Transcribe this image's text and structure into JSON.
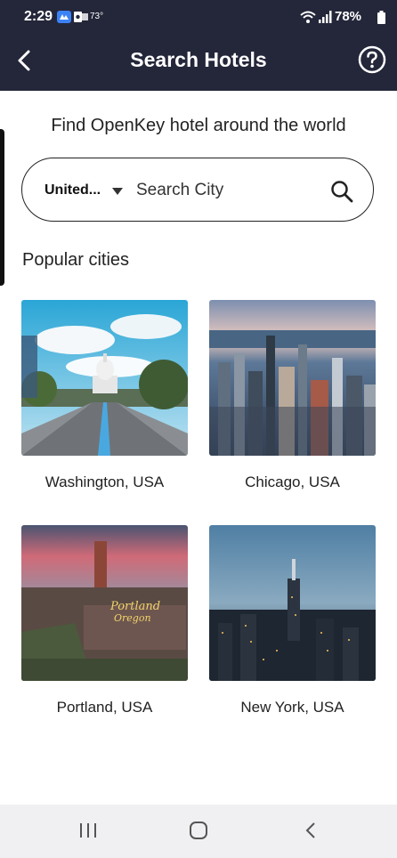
{
  "status_bar": {
    "time": "2:29",
    "temperature": "73°",
    "battery": "78%",
    "icons": [
      "app-notification-icon",
      "outlook-icon",
      "wifi-icon",
      "signal-icon",
      "battery-icon"
    ]
  },
  "header": {
    "title": "Search Hotels",
    "back_icon": "back-chevron-icon",
    "help_icon": "help-circle-icon"
  },
  "main": {
    "subtitle": "Find OpenKey hotel around the world",
    "search": {
      "country": "United...",
      "placeholder": "Search City",
      "value": ""
    },
    "popular_title": "Popular cities",
    "cities": [
      {
        "label": "Washington, USA"
      },
      {
        "label": "Chicago, USA"
      },
      {
        "label": "Portland, USA"
      },
      {
        "label": "New York, USA"
      }
    ]
  },
  "nav_bar": {
    "icons": [
      "recent-apps-icon",
      "home-icon",
      "back-icon"
    ]
  },
  "colors": {
    "header_bg": "#24273a",
    "text": "#222222",
    "nav_bg": "#f0f0f3"
  }
}
